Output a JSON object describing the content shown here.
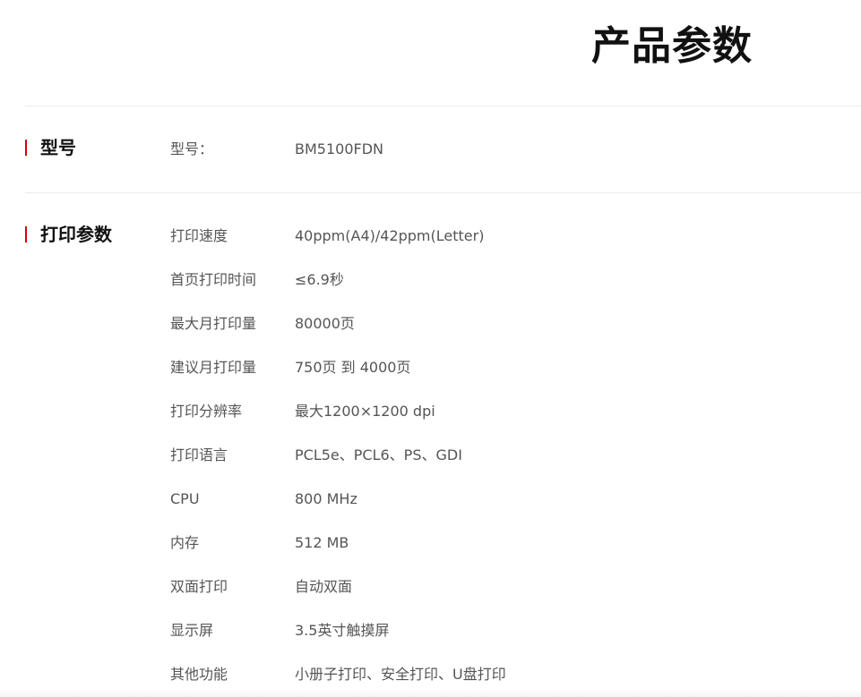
{
  "page": {
    "title": "产品参数"
  },
  "sections": {
    "model": {
      "title": "型号",
      "rows": [
        {
          "label": "型号：",
          "value": "BM5100FDN"
        }
      ]
    },
    "print": {
      "title": "打印参数",
      "rows": [
        {
          "label": "打印速度",
          "value": "40ppm(A4)/42ppm(Letter)"
        },
        {
          "label": "首页打印时间",
          "value": "≤6.9秒"
        },
        {
          "label": "最大月打印量",
          "value": "80000页"
        },
        {
          "label": "建议月打印量",
          "value": "750页 到 4000页"
        },
        {
          "label": "打印分辨率",
          "value": "最大1200×1200 dpi"
        },
        {
          "label": "打印语言",
          "value": "PCL5e、PCL6、PS、GDI"
        },
        {
          "label": "CPU",
          "value": "800 MHz"
        },
        {
          "label": "内存",
          "value": "512 MB"
        },
        {
          "label": "双面打印",
          "value": "自动双面"
        },
        {
          "label": "显示屏",
          "value": "3.5英寸触摸屏"
        },
        {
          "label": "其他功能",
          "value": "小册子打印、安全打印、U盘打印"
        }
      ]
    }
  },
  "colors": {
    "accent": "#d7000f",
    "text": "#555555",
    "heading": "#111111",
    "divider": "#ececec"
  }
}
